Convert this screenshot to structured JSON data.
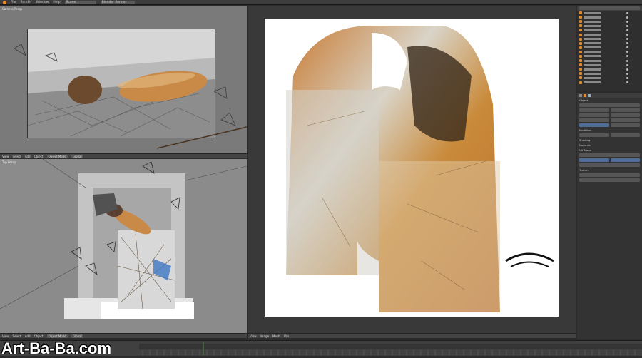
{
  "menubar": {
    "items": [
      "File",
      "Render",
      "Window",
      "Help"
    ],
    "scene_field": "Scene",
    "render_engine": "Blender Render"
  },
  "viewport_top": {
    "label": "Camera Persp"
  },
  "viewport_bottom": {
    "label": "Top Persp"
  },
  "viewport_header": {
    "items": [
      "View",
      "Select",
      "Add",
      "Object",
      "Object Mode",
      "Global"
    ]
  },
  "properties": {
    "section_object": "Object",
    "section_modifiers": "Modifiers",
    "section_shading": "Shading",
    "section_normals": "Normals",
    "section_uv_maps": "UV Maps",
    "section_texture": "Texture"
  },
  "image_editor": {
    "header_items": [
      "View",
      "Image",
      "Mesh",
      "UVs"
    ]
  },
  "watermark": "Art-Ba-Ba.com",
  "colors": {
    "accent_orange": "#e28a2b",
    "active_blue": "#4f6d97",
    "panel_bg": "#333333",
    "image_bg": "#ffffff"
  }
}
